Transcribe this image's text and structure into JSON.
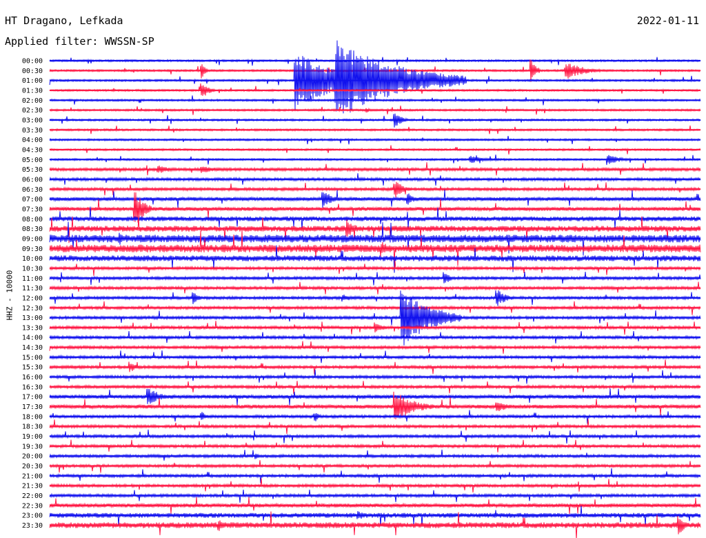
{
  "header": {
    "station": "HT Dragano, Lefkada",
    "date": "2022-01-11",
    "filter": "Applied filter: WWSSN-SP"
  },
  "chart_data": {
    "type": "line",
    "title": "HT Dragano, Lefkada",
    "date": "2022-01-11",
    "filter_label": "Applied filter: WWSSN-SP",
    "ylabel": "HHZ - 10000",
    "colors": [
      "#1010ee",
      "#ff1744"
    ],
    "line_labels": [
      "00:00",
      "00:30",
      "01:00",
      "01:30",
      "02:00",
      "02:30",
      "03:00",
      "03:30",
      "04:00",
      "04:30",
      "05:00",
      "05:30",
      "06:00",
      "06:30",
      "07:00",
      "07:30",
      "08:00",
      "08:30",
      "09:00",
      "09:30",
      "10:00",
      "10:30",
      "11:00",
      "11:30",
      "12:00",
      "12:30",
      "13:00",
      "13:30",
      "14:00",
      "14:30",
      "15:00",
      "15:30",
      "16:00",
      "16:30",
      "17:00",
      "17:30",
      "18:00",
      "18:30",
      "19:00",
      "19:30",
      "20:00",
      "20:30",
      "21:00",
      "21:30",
      "22:00",
      "22:30",
      "23:00",
      "23:30"
    ],
    "x_unit": "minutes",
    "xlim": [
      0,
      30
    ],
    "noise_level": [
      1,
      1,
      1,
      1,
      1,
      1,
      1,
      1,
      1,
      1,
      1,
      1.5,
      1.5,
      1.5,
      2,
      2,
      2.5,
      3,
      4,
      4,
      3,
      1.5,
      1.5,
      1.5,
      1.5,
      1.5,
      1.5,
      1.5,
      1.5,
      1.5,
      1.5,
      1.5,
      1.5,
      1.5,
      2,
      2,
      1.5,
      1.5,
      1.5,
      1.5,
      1.5,
      1.5,
      1.5,
      1.5,
      1.5,
      2,
      2.5,
      3
    ],
    "events": [
      {
        "line": 2,
        "minute": 11.3,
        "amp": 45,
        "duration": 4
      },
      {
        "line": 2,
        "minute": 13.2,
        "amp": 60,
        "duration": 6
      },
      {
        "line": 1,
        "minute": 7.0,
        "amp": 12,
        "duration": 0.3
      },
      {
        "line": 1,
        "minute": 22.2,
        "amp": 18,
        "duration": 0.4
      },
      {
        "line": 1,
        "minute": 23.8,
        "amp": 14,
        "duration": 1.6
      },
      {
        "line": 3,
        "minute": 7.0,
        "amp": 14,
        "duration": 0.6
      },
      {
        "line": 6,
        "minute": 15.9,
        "amp": 12,
        "duration": 0.6
      },
      {
        "line": 5,
        "minute": 14.6,
        "amp": 4,
        "duration": 0.3
      },
      {
        "line": 10,
        "minute": 19.4,
        "amp": 6,
        "duration": 1.2
      },
      {
        "line": 10,
        "minute": 25.7,
        "amp": 8,
        "duration": 1.2
      },
      {
        "line": 11,
        "minute": 5.0,
        "amp": 6,
        "duration": 1.5
      },
      {
        "line": 11,
        "minute": 7.0,
        "amp": 6,
        "duration": 1.5
      },
      {
        "line": 13,
        "minute": 15.9,
        "amp": 14,
        "duration": 0.8
      },
      {
        "line": 14,
        "minute": 12.6,
        "amp": 14,
        "duration": 0.8
      },
      {
        "line": 14,
        "minute": 16.5,
        "amp": 10,
        "duration": 0.5
      },
      {
        "line": 15,
        "minute": 3.9,
        "amp": 30,
        "duration": 0.8
      },
      {
        "line": 17,
        "minute": 13.7,
        "amp": 14,
        "duration": 0.8
      },
      {
        "line": 18,
        "minute": 3.2,
        "amp": 10,
        "duration": 0.6
      },
      {
        "line": 19,
        "minute": 15.3,
        "amp": 12,
        "duration": 0.6
      },
      {
        "line": 22,
        "minute": 18.2,
        "amp": 12,
        "duration": 0.4
      },
      {
        "line": 24,
        "minute": 6.6,
        "amp": 12,
        "duration": 0.4
      },
      {
        "line": 24,
        "minute": 13.5,
        "amp": 6,
        "duration": 1.0
      },
      {
        "line": 24,
        "minute": 20.6,
        "amp": 14,
        "duration": 0.8
      },
      {
        "line": 26,
        "minute": 16.2,
        "amp": 45,
        "duration": 2.8
      },
      {
        "line": 26,
        "minute": 17.6,
        "amp": 12,
        "duration": 0.6
      },
      {
        "line": 27,
        "minute": 15.0,
        "amp": 8,
        "duration": 0.8
      },
      {
        "line": 31,
        "minute": 3.7,
        "amp": 8,
        "duration": 0.6
      },
      {
        "line": 34,
        "minute": 4.5,
        "amp": 14,
        "duration": 1.2
      },
      {
        "line": 35,
        "minute": 15.9,
        "amp": 24,
        "duration": 1.8
      },
      {
        "line": 35,
        "minute": 20.6,
        "amp": 8,
        "duration": 1.2
      },
      {
        "line": 36,
        "minute": 7.0,
        "amp": 8,
        "duration": 0.4
      },
      {
        "line": 36,
        "minute": 12.2,
        "amp": 8,
        "duration": 0.4
      },
      {
        "line": 40,
        "minute": 9.5,
        "amp": 5,
        "duration": 0.3
      },
      {
        "line": 46,
        "minute": 14.2,
        "amp": 8,
        "duration": 0.6
      },
      {
        "line": 47,
        "minute": 7.8,
        "amp": 10,
        "duration": 0.4
      },
      {
        "line": 47,
        "minute": 29.0,
        "amp": 18,
        "duration": 0.4
      }
    ]
  }
}
